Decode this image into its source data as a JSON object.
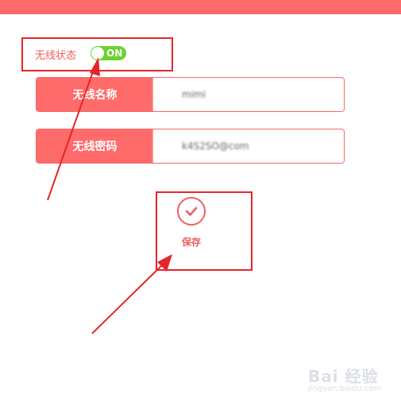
{
  "wireless_status": {
    "label": "无线状态",
    "toggle_text": "ON"
  },
  "fields": [
    {
      "label": "无线名称",
      "value": "mimi"
    },
    {
      "label": "无线密码",
      "value": "k4S2SO@com"
    }
  ],
  "save": {
    "label": "保存"
  },
  "watermark": {
    "main": "Bai 经验",
    "sub": "jingyan.baidu.com"
  },
  "colors": {
    "accent": "#ff6a6a",
    "toggle_on": "#6bd22d",
    "annotation": "#e5252a"
  },
  "icons": {
    "toggle": "toggle-switch",
    "save": "checkmark-circle-icon"
  }
}
